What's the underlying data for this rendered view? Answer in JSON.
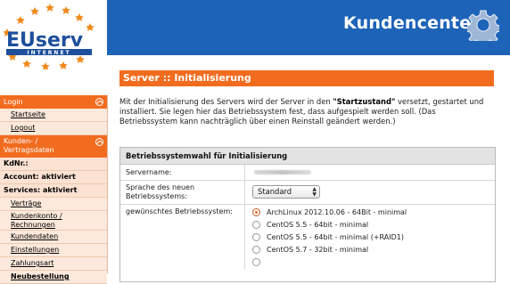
{
  "header": {
    "brand_title": "Kundencenter",
    "logo_text_main": "EUserv",
    "logo_text_sub": "INTERNET",
    "colors": {
      "header_blue": "#1d63b8",
      "accent_orange": "#f26c1f"
    }
  },
  "sidebar": {
    "sections": [
      {
        "label": "Login",
        "links": [
          "Startseite",
          "Logout"
        ]
      },
      {
        "label": "Kunden- / Vertragsdaten"
      }
    ],
    "kdnr_label": "KdNr.:",
    "account_status": "Account: aktiviert",
    "services_status": "Services: aktiviert",
    "links": [
      "Verträge",
      "Kundenkonto / Rechnungen",
      "Kundendaten",
      "Einstellungen",
      "Zahlungsart",
      "Neubestellung"
    ]
  },
  "main": {
    "title": "Server :: Initialisierung",
    "intro_part1": "Mit der Initialisierung des Servers wird der Server in den ",
    "intro_bold": "\"Startzustand\"",
    "intro_part2": " versetzt, gestartet und installiert. Sie legen hier das Betriebssystem fest, dass aufgespielt werden soll. (Das Betriebssystem kann nachträglich über einen Reinstall geändert werden.)",
    "panel": {
      "title": "Betriebssystemwahl für Initialisierung",
      "servername_label": "Servername:",
      "language_label": "Sprache des neuen Betriebssystems:",
      "language_value": "Standard",
      "os_label": "gewünschtes Betriebssystem:",
      "os_options": [
        {
          "label": "ArchLinux 2012.10.06 - 64Bit - minimal",
          "selected": true
        },
        {
          "label": "CentOS 5.5 - 64bit - minimal",
          "selected": false
        },
        {
          "label": "CentOS 5.5 - 64bit - minimal (+RAID1)",
          "selected": false
        },
        {
          "label": "CentOS 5.7 - 32bit - minimal",
          "selected": false
        },
        {
          "label": "",
          "selected": false
        }
      ]
    }
  }
}
